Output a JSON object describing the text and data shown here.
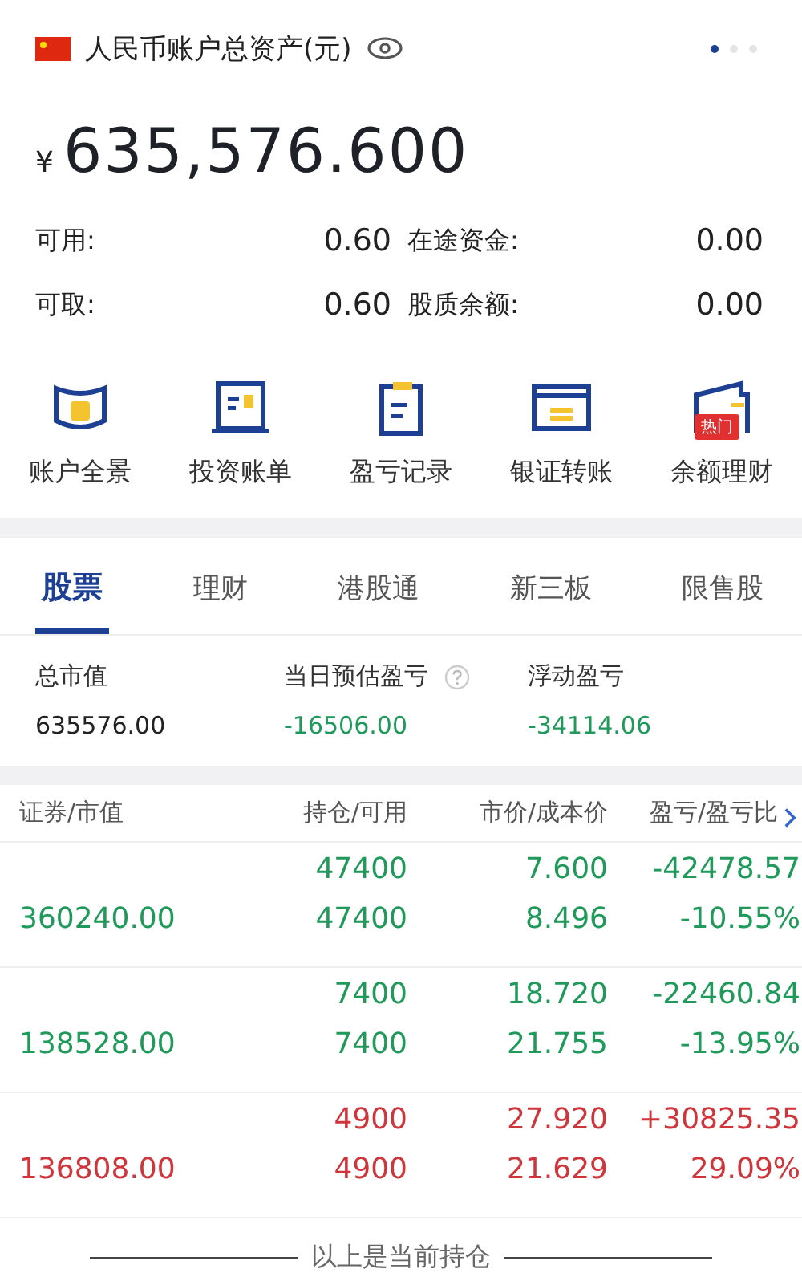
{
  "header": {
    "title": "人民币账户总资产(元)",
    "pages": [
      {
        "selected": true
      },
      {
        "selected": false
      },
      {
        "selected": false
      }
    ]
  },
  "total": {
    "currency": "¥",
    "amount": "635,576.600"
  },
  "balances": [
    {
      "label": "可用:",
      "value": "0.60"
    },
    {
      "label": "在途资金:",
      "value": "0.00"
    },
    {
      "label": "可取:",
      "value": "0.60"
    },
    {
      "label": "股质余额:",
      "value": "0.00"
    }
  ],
  "shortcuts": [
    {
      "kind": "overview",
      "label": "账户全景"
    },
    {
      "kind": "bill",
      "label": "投资账单"
    },
    {
      "kind": "record",
      "label": "盈亏记录"
    },
    {
      "kind": "transfer",
      "label": "银证转账"
    },
    {
      "kind": "wallet",
      "label": "余额理财",
      "badge": "热门"
    }
  ],
  "tabs": [
    {
      "label": "股票",
      "selected": true
    },
    {
      "label": "理财",
      "selected": false
    },
    {
      "label": "港股通",
      "selected": false
    },
    {
      "label": "新三板",
      "selected": false
    },
    {
      "label": "限售股",
      "selected": false
    }
  ],
  "summary": [
    {
      "label": "总市值",
      "value": "635576.00",
      "color": "#222222",
      "help": false
    },
    {
      "label": "当日预估盈亏",
      "value": "-16506.00",
      "color": "#1f9a5a",
      "help": true
    },
    {
      "label": "浮动盈亏",
      "value": "-34114.06",
      "color": "#1f9a5a",
      "help": false
    }
  ],
  "table": {
    "columns": [
      "证券/市值",
      "持仓/可用",
      "市价/成本价",
      "盈亏/盈亏比"
    ],
    "rows": [
      {
        "color": "#1f9a5a",
        "market_value": "360240.00",
        "holding": "47400",
        "available": "47400",
        "price": "7.600",
        "cost": "8.496",
        "pnl": "-42478.57",
        "pnl_ratio": "-10.55%"
      },
      {
        "color": "#1f9a5a",
        "market_value": "138528.00",
        "holding": "7400",
        "available": "7400",
        "price": "18.720",
        "cost": "21.755",
        "pnl": "-22460.84",
        "pnl_ratio": "-13.95%"
      },
      {
        "color": "#d0353b",
        "market_value": "136808.00",
        "holding": "4900",
        "available": "4900",
        "price": "27.920",
        "cost": "21.629",
        "pnl": "+30825.35",
        "pnl_ratio": "29.09%"
      }
    ]
  },
  "footer": "以上是当前持仓"
}
